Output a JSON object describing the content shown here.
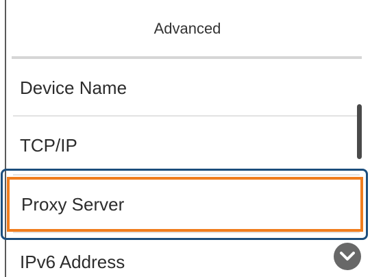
{
  "header": {
    "title": "Advanced"
  },
  "menu": {
    "items": [
      {
        "label": "Device Name"
      },
      {
        "label": "TCP/IP"
      },
      {
        "label": "Proxy Server",
        "selected": true
      },
      {
        "label": "IPv6 Address"
      }
    ]
  },
  "scroll": {
    "down_icon": "chevron-down-icon"
  },
  "colors": {
    "selection": "#f07d1e",
    "callout": "#1c4e7d"
  }
}
